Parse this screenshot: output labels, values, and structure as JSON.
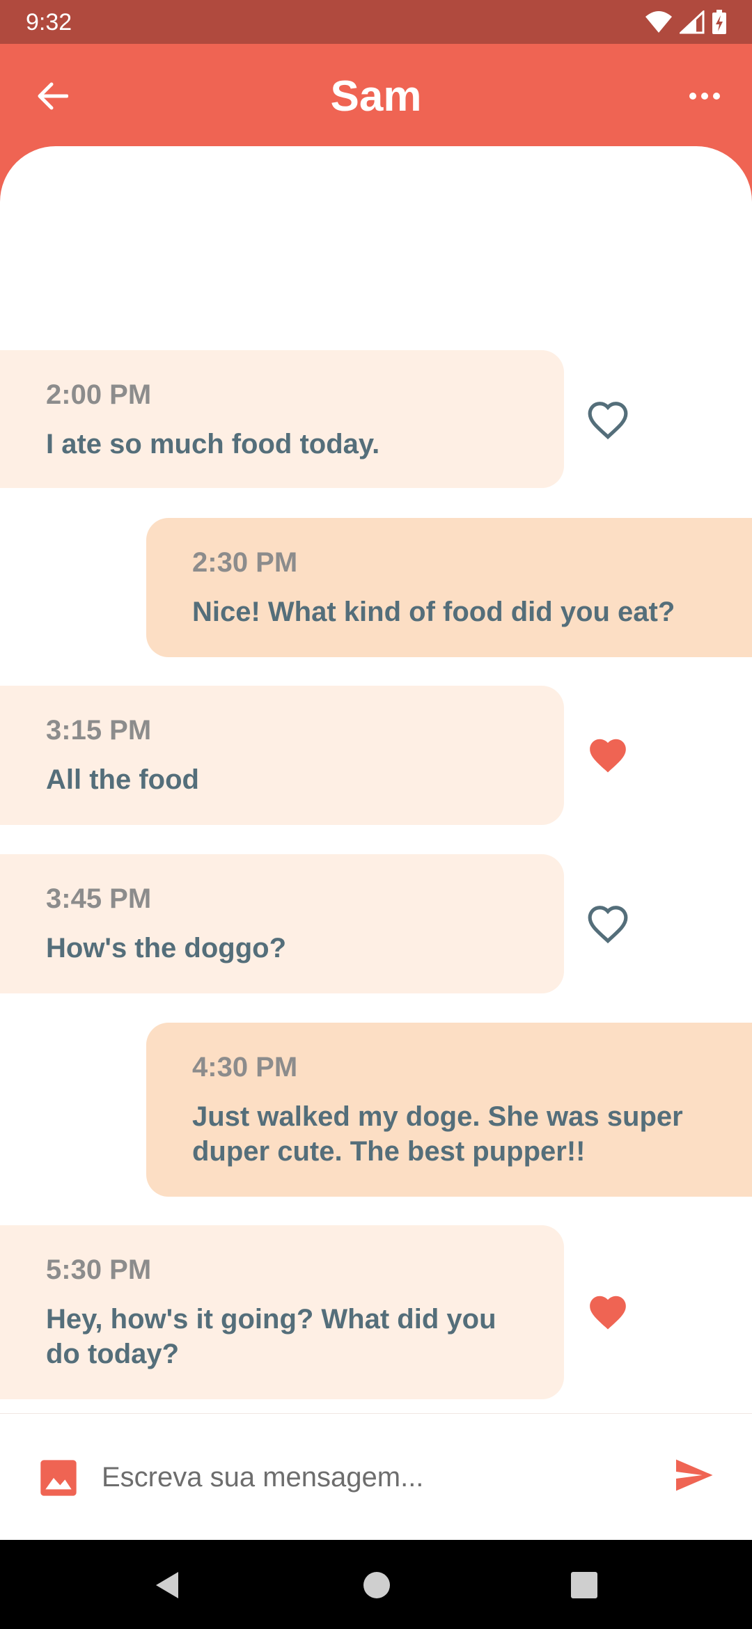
{
  "status_bar": {
    "time": "9:32",
    "icons": [
      "wifi-icon",
      "cell-signal-icon",
      "battery-charging-icon"
    ]
  },
  "header": {
    "title": "Sam",
    "back_icon": "arrow-left-icon",
    "menu_icon": "more-horizontal-icon"
  },
  "messages": [
    {
      "direction": "received",
      "time": "2:00 PM",
      "text": "I ate so much food today.",
      "liked": false
    },
    {
      "direction": "sent",
      "time": "2:30 PM",
      "text": "Nice! What kind of food did you eat?"
    },
    {
      "direction": "received",
      "time": "3:15 PM",
      "text": "All the food",
      "liked": true
    },
    {
      "direction": "received",
      "time": "3:45 PM",
      "text": "How's the doggo?",
      "liked": false
    },
    {
      "direction": "sent",
      "time": "4:30 PM",
      "text": "Just walked my doge. She was super duper cute. The best pupper!!"
    },
    {
      "direction": "received",
      "time": "5:30 PM",
      "text": "Hey, how's it going? What did you do today?",
      "liked": true
    }
  ],
  "composer": {
    "placeholder": "Escreva sua mensagem...",
    "value": "",
    "image_icon": "image-icon",
    "send_icon": "send-icon"
  },
  "colors": {
    "accent": "#ef6453",
    "status_bar": "#b04a3e",
    "received_bubble": "#feefe4",
    "sent_bubble": "#fcdec4",
    "message_text": "#546e7a",
    "time_text": "#8c8c8c",
    "heart_outline": "#546e7a"
  },
  "nav_bar": {
    "icons": [
      "nav-back-icon",
      "nav-home-icon",
      "nav-recents-icon"
    ]
  }
}
